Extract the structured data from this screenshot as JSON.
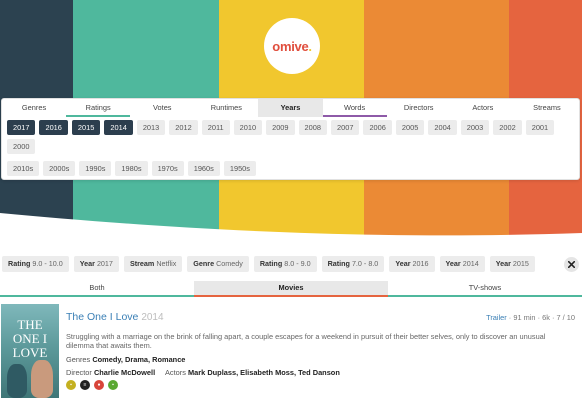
{
  "brand": {
    "logo_text": "omive",
    "logo_dot": "."
  },
  "colors": {
    "stripes": [
      "#2c4250",
      "#4fb89d",
      "#f1c72e",
      "#eb8a35",
      "#e5643f"
    ],
    "selected_chip": "#2c3e4e",
    "link": "#3a7fb5"
  },
  "categories": [
    {
      "label": "Genres"
    },
    {
      "label": "Ratings"
    },
    {
      "label": "Votes"
    },
    {
      "label": "Runtimes"
    },
    {
      "label": "Years"
    },
    {
      "label": "Words"
    },
    {
      "label": "Directors"
    },
    {
      "label": "Actors"
    },
    {
      "label": "Streams"
    }
  ],
  "active_category": "Years",
  "years": [
    "2017",
    "2016",
    "2015",
    "2014",
    "2013",
    "2012",
    "2011",
    "2010",
    "2009",
    "2008",
    "2007",
    "2006",
    "2005",
    "2004",
    "2003",
    "2002",
    "2001",
    "2000"
  ],
  "selected_years": [
    "2017",
    "2016",
    "2015",
    "2014"
  ],
  "decades": [
    "2010s",
    "2000s",
    "1990s",
    "1980s",
    "1970s",
    "1960s",
    "1950s"
  ],
  "active_filters": [
    {
      "key": "Rating",
      "value": "9.0 - 10.0"
    },
    {
      "key": "Year",
      "value": "2017"
    },
    {
      "key": "Stream",
      "value": "Netflix"
    },
    {
      "key": "Genre",
      "value": "Comedy"
    },
    {
      "key": "Rating",
      "value": "8.0 - 9.0"
    },
    {
      "key": "Rating",
      "value": "7.0 - 8.0"
    },
    {
      "key": "Year",
      "value": "2016"
    },
    {
      "key": "Year",
      "value": "2014"
    },
    {
      "key": "Year",
      "value": "2015"
    }
  ],
  "close_icon": "✖",
  "type_tabs": [
    "Both",
    "Movies",
    "TV-shows"
  ],
  "active_type_tab": "Movies",
  "movie": {
    "title": "The One I Love",
    "year": "2014",
    "trailer_label": "Trailer",
    "runtime": "91 min",
    "votes": "6k",
    "rating": "7",
    "rating_max": "/ 10",
    "plot": "Struggling with a marriage on the brink of falling apart, a couple escapes for a weekend in pursuit of their better selves, only to discover an unusual dilemma that awaits them.",
    "genres_label": "Genres",
    "genres": "Comedy, Drama, Romance",
    "director_label": "Director",
    "director": "Charlie McDowell",
    "actors_label": "Actors",
    "actors": "Mark Duplass, Elisabeth Moss, Ted Danson",
    "poster_title": "THE ONE I LOVE",
    "poster_title_lines": [
      "THE",
      "ONE I",
      "LOVE"
    ],
    "providers": [
      {
        "icon": "imdb-icon",
        "color": "#c4b020"
      },
      {
        "icon": "streaming-icon",
        "color": "#222222"
      },
      {
        "icon": "tomato-icon",
        "color": "#d8453a"
      },
      {
        "icon": "service-icon",
        "color": "#5aa832"
      }
    ]
  }
}
